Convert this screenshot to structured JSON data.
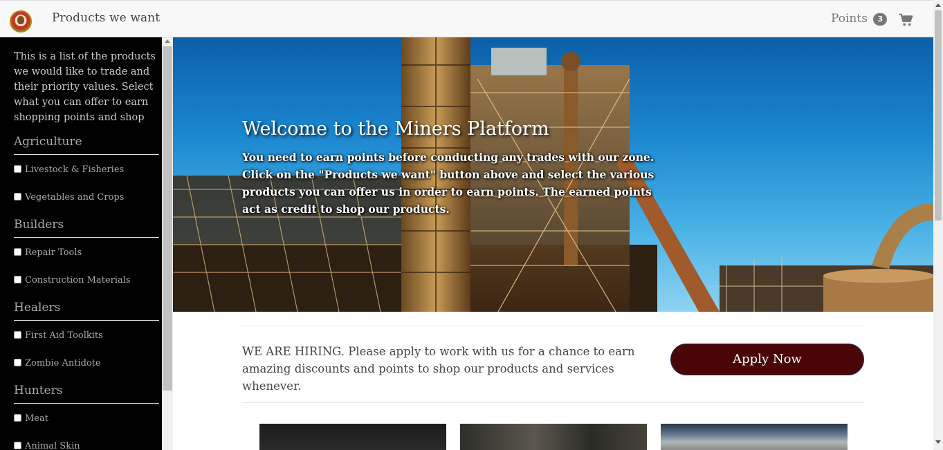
{
  "navbar": {
    "brand": "Products we want",
    "points_label": "Points",
    "points_count": "3",
    "logo_icon": "miner-logo-icon",
    "cart_icon": "shopping-cart-icon"
  },
  "sidebar": {
    "intro": "This is a list of the products we would like to trade and their priority values. Select what you can offer to earn shopping points and shop",
    "categories": [
      {
        "name": "Agriculture",
        "items": [
          "Livestock & Fisheries",
          "Vegetables and Crops"
        ]
      },
      {
        "name": "Builders",
        "items": [
          "Repair Tools",
          "Construction Materials"
        ]
      },
      {
        "name": "Healers",
        "items": [
          "First Aid Toolkits",
          "Zombie Antidote"
        ]
      },
      {
        "name": "Hunters",
        "items": [
          "Meat",
          "Animal Skin"
        ]
      }
    ]
  },
  "hero": {
    "title": "Welcome to the Miners Platform",
    "text": "You need to earn points before conducting any trades with our zone. Click on the \"Products we want\" button above and select the various products you can offer us in order to earn points. The earned points act as credit to shop our products."
  },
  "hiring": {
    "text": "WE ARE HIRING. Please apply to work with us for a chance to earn amazing discounts and points to shop our products and services whenever.",
    "button": "Apply Now"
  },
  "colors": {
    "apply_button": "#4a0606",
    "sidebar_bg": "#000000",
    "navbar_bg": "#f8f8f8"
  }
}
